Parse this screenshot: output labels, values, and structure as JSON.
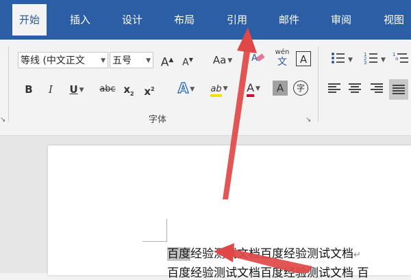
{
  "tabs": [
    {
      "label": "开始",
      "active": true
    },
    {
      "label": "插入"
    },
    {
      "label": "设计"
    },
    {
      "label": "布局"
    },
    {
      "label": "引用"
    },
    {
      "label": "邮件"
    },
    {
      "label": "审阅"
    },
    {
      "label": "视图"
    }
  ],
  "font": {
    "family_value": "等线 (中文正文",
    "size_value": "五号",
    "grow_label": "A",
    "shrink_label": "A",
    "case_label": "Aa",
    "phonetic_top": "wén",
    "phonetic_bottom": "文",
    "border_char_label": "A",
    "bold_label": "B",
    "italic_label": "I",
    "underline_label": "U",
    "strike_label": "abc",
    "sub_label": "x",
    "sub_mark": "2",
    "sup_label": "x",
    "sup_mark": "2",
    "effects_label": "A",
    "highlight_label": "ab",
    "color_label": "A",
    "shade_label": "A",
    "enclose_label": "字",
    "group_label": "字体"
  },
  "colors": {
    "tabbar": "#2c5ea6",
    "highlight": "#f5e100",
    "font_color": "#c8102e",
    "arrow": "#e04848"
  },
  "document": {
    "line1_selected": "百度",
    "line1_rest": "经验测试文档百度经验测试文档",
    "paragraph_mark": "↵",
    "line2": "百度经验测试文档百度经验测试文档 百"
  }
}
